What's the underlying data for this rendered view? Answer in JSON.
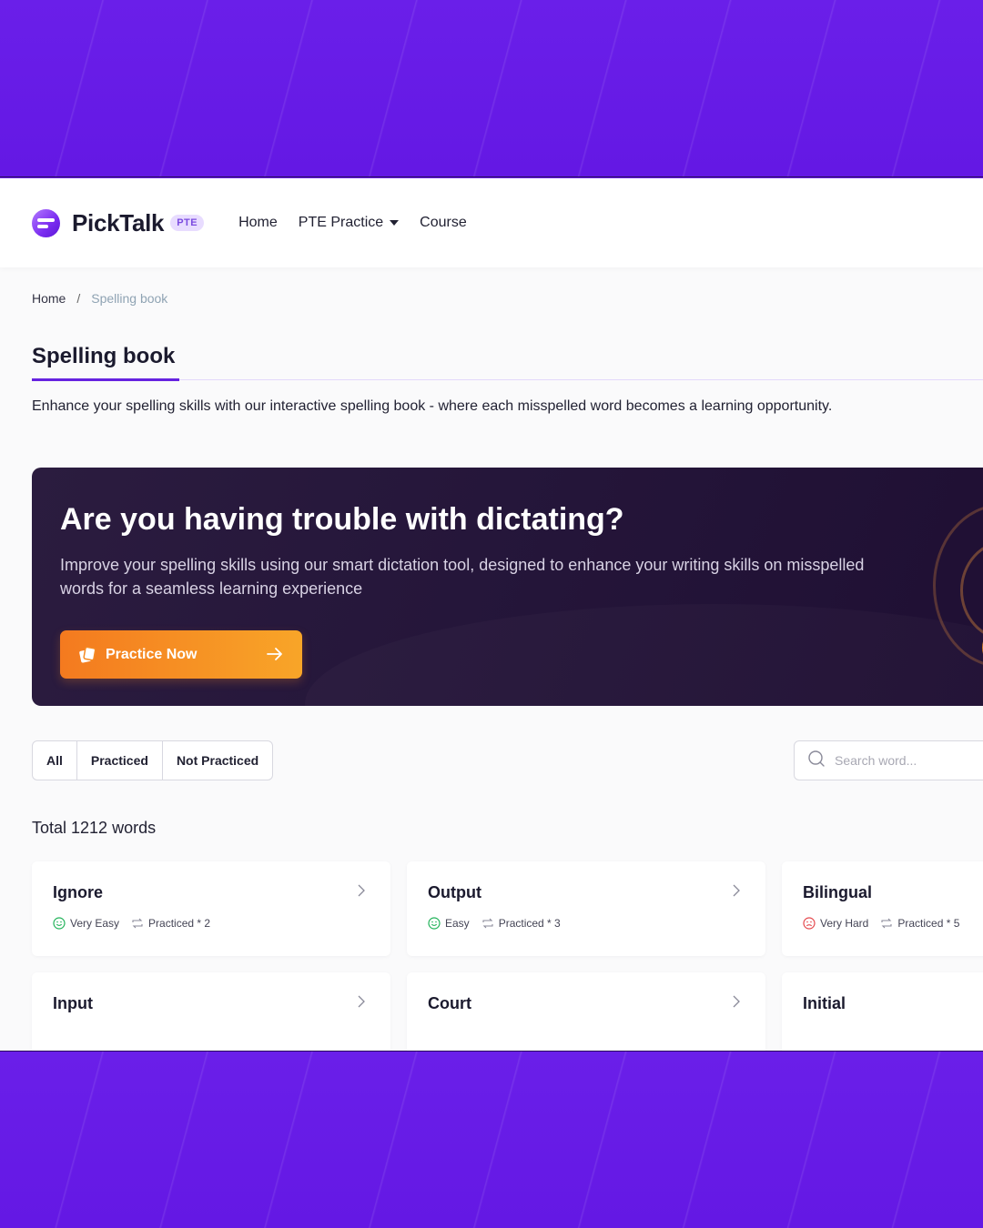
{
  "brand": {
    "name": "PickTalk",
    "badge": "PTE"
  },
  "nav": {
    "home": "Home",
    "pte_practice": "PTE Practice",
    "course": "Course"
  },
  "breadcrumb": {
    "home": "Home",
    "separator": "/",
    "current": "Spelling book"
  },
  "page": {
    "title": "Spelling book",
    "description": "Enhance your spelling skills with our interactive spelling book - where each misspelled word becomes a learning opportunity."
  },
  "promo": {
    "title": "Are you having trouble with dictating?",
    "text": "Improve your spelling skills using our smart dictation tool, designed to enhance your writing skills on misspelled words for a seamless learning experience",
    "button": "Practice Now"
  },
  "filters": {
    "all": "All",
    "practiced": "Practiced",
    "not_practiced": "Not Practiced"
  },
  "search": {
    "placeholder": "Search word..."
  },
  "total": "Total 1212 words",
  "words": [
    {
      "word": "Ignore",
      "difficulty": "Very Easy",
      "difficulty_color": "#22b35a",
      "practiced": "Practiced * 2"
    },
    {
      "word": "Output",
      "difficulty": "Easy",
      "difficulty_color": "#22b35a",
      "practiced": "Practiced * 3"
    },
    {
      "word": "Bilingual",
      "difficulty": "Very Hard",
      "difficulty_color": "#e5484d",
      "practiced": "Practiced * 5"
    },
    {
      "word": "Input",
      "difficulty": "",
      "difficulty_color": "#22b35a",
      "practiced": ""
    },
    {
      "word": "Court",
      "difficulty": "",
      "difficulty_color": "#e5484d",
      "practiced": ""
    },
    {
      "word": "Initial",
      "difficulty": "",
      "difficulty_color": "#22b35a",
      "practiced": ""
    }
  ],
  "colors": {
    "accent": "#6622e0",
    "button_start": "#f47a1f",
    "button_end": "#f8a528",
    "background_band": "#6a1ee8"
  }
}
